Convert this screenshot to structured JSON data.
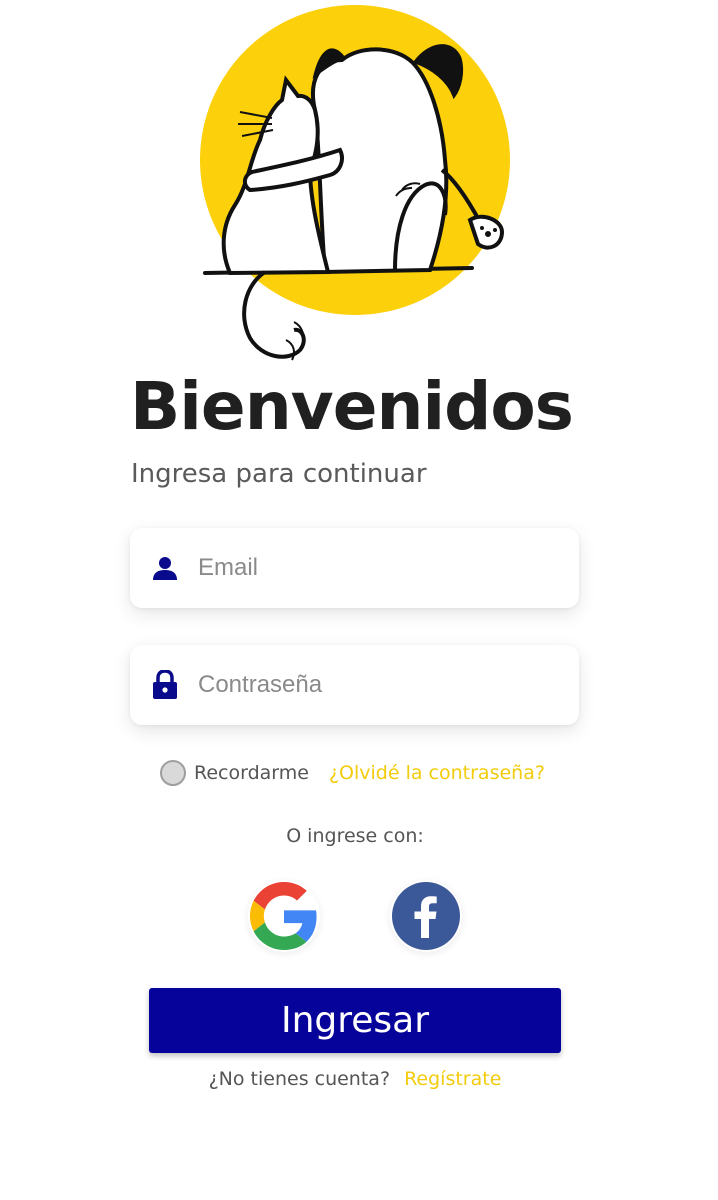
{
  "hero": {
    "illustration": "cat-and-dog-hugging-illustration",
    "accent_color": "#fcd00a"
  },
  "header": {
    "title": "Bienvenidos",
    "subtitle": "Ingresa para continuar"
  },
  "form": {
    "email": {
      "icon": "user-icon",
      "placeholder": "Email",
      "value": ""
    },
    "password": {
      "icon": "lock-icon",
      "placeholder": "Contraseña",
      "value": ""
    },
    "remember_label": "Recordarme",
    "remember_checked": false,
    "forgot_label": "¿Olvidé la contraseña?"
  },
  "social": {
    "label": "O ingrese con:",
    "providers": [
      {
        "name": "google",
        "icon": "google-icon"
      },
      {
        "name": "facebook",
        "icon": "facebook-icon"
      }
    ]
  },
  "actions": {
    "submit_label": "Ingresar",
    "no_account_text": "¿No tienes cuenta?",
    "register_label": "Regístrate"
  },
  "colors": {
    "primary": "#06039a",
    "accent": "#f2cc0c",
    "icon": "#0a0a8c",
    "facebook": "#3b5998"
  }
}
